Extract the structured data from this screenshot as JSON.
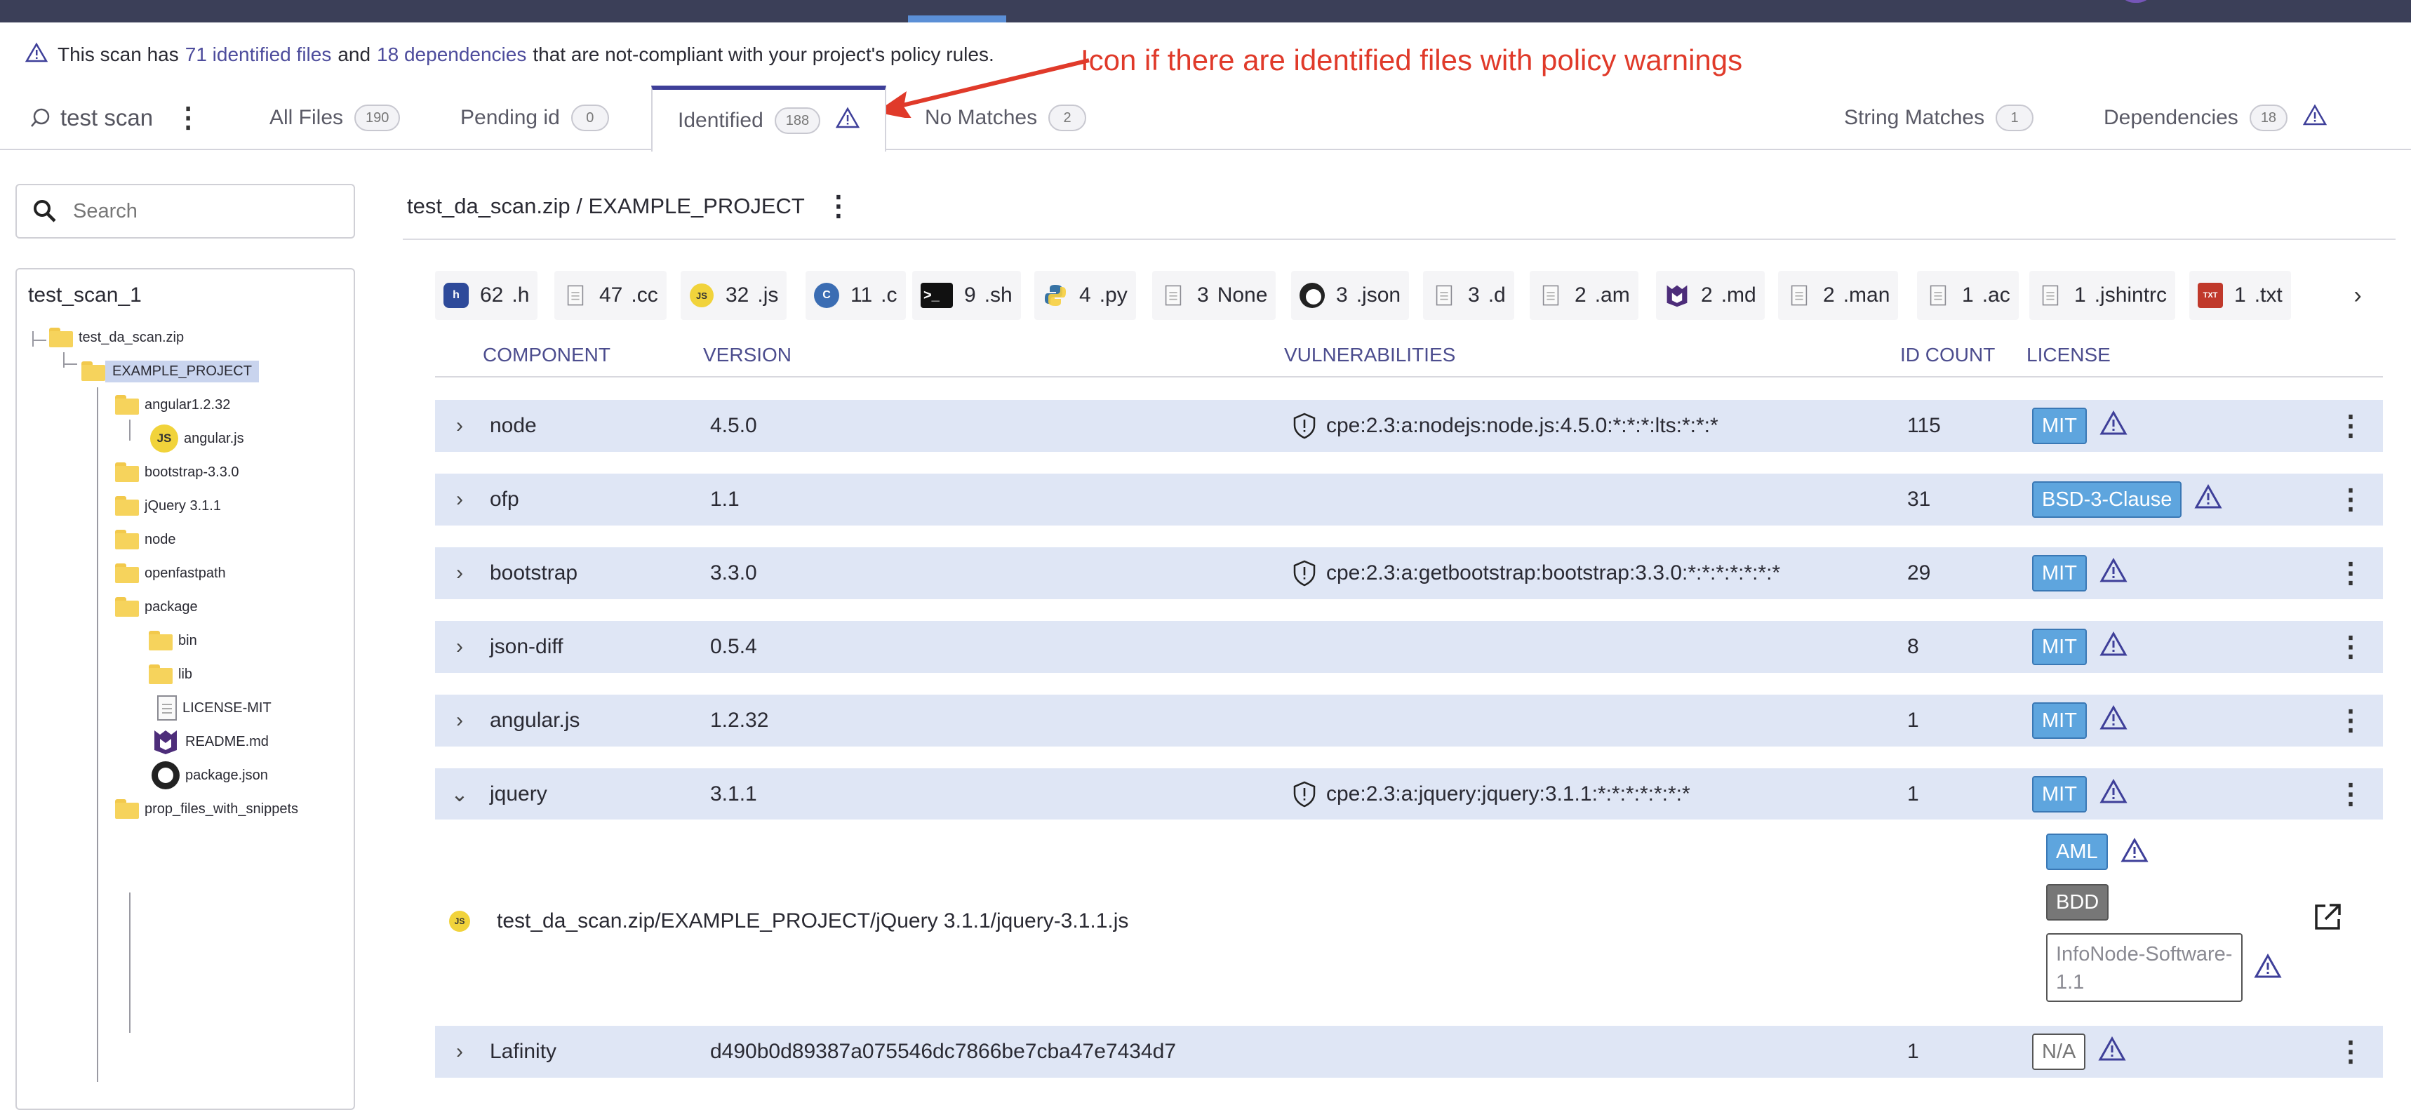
{
  "notice": {
    "prefix": "This scan has",
    "identified_link": "71 identified files",
    "middle": "and",
    "dependencies_link": "18 dependencies",
    "suffix": "that are not-compliant with your project's policy rules."
  },
  "annotation": {
    "text": "Icon if there are identified files with policy warnings"
  },
  "scan": {
    "name": "test scan"
  },
  "tabs": [
    {
      "label": "All Files",
      "count": "190"
    },
    {
      "label": "Pending id",
      "count": "0"
    },
    {
      "label": "Identified",
      "count": "188"
    },
    {
      "label": "No Matches",
      "count": "2"
    },
    {
      "label": "String Matches",
      "count": "1"
    },
    {
      "label": "Dependencies",
      "count": "18"
    }
  ],
  "search": {
    "placeholder": "Search"
  },
  "tree": {
    "root": "test_scan_1",
    "nodes": [
      {
        "label": "test_da_scan.zip",
        "icon": "folder-icon"
      },
      {
        "label": "EXAMPLE_PROJECT",
        "icon": "folder-icon"
      },
      {
        "label": "angular1.2.32",
        "icon": "folder-icon"
      },
      {
        "label": "angular.js",
        "icon": "javascript-icon"
      },
      {
        "label": "bootstrap-3.3.0",
        "icon": "folder-icon"
      },
      {
        "label": "jQuery 3.1.1",
        "icon": "folder-icon"
      },
      {
        "label": "node",
        "icon": "folder-icon"
      },
      {
        "label": "openfastpath",
        "icon": "folder-icon"
      },
      {
        "label": "package",
        "icon": "folder-icon"
      },
      {
        "label": "bin",
        "icon": "folder-icon"
      },
      {
        "label": "lib",
        "icon": "folder-icon"
      },
      {
        "label": "LICENSE-MIT",
        "icon": "document-icon"
      },
      {
        "label": "README.md",
        "icon": "markdown-icon"
      },
      {
        "label": "package.json",
        "icon": "json-icon"
      },
      {
        "label": "prop_files_with_snippets",
        "icon": "folder-icon"
      }
    ]
  },
  "breadcrumb": {
    "path": "test_da_scan.zip / EXAMPLE_PROJECT"
  },
  "extensions": [
    {
      "count": "62",
      "ext": ".h",
      "icon": "h-file-icon"
    },
    {
      "count": "47",
      "ext": ".cc",
      "icon": "document-icon"
    },
    {
      "count": "32",
      "ext": ".js",
      "icon": "javascript-icon"
    },
    {
      "count": "11",
      "ext": ".c",
      "icon": "c-file-icon"
    },
    {
      "count": "9",
      "ext": ".sh",
      "icon": "terminal-icon"
    },
    {
      "count": "4",
      "ext": ".py",
      "icon": "python-icon"
    },
    {
      "count": "3",
      "ext": "None",
      "icon": "document-icon"
    },
    {
      "count": "3",
      "ext": ".json",
      "icon": "json-icon"
    },
    {
      "count": "3",
      "ext": ".d",
      "icon": "document-icon"
    },
    {
      "count": "2",
      "ext": ".am",
      "icon": "document-icon"
    },
    {
      "count": "2",
      "ext": ".md",
      "icon": "markdown-icon"
    },
    {
      "count": "2",
      "ext": ".man",
      "icon": "document-icon"
    },
    {
      "count": "1",
      "ext": ".ac",
      "icon": "document-icon"
    },
    {
      "count": "1",
      "ext": ".jshintrc",
      "icon": "document-icon"
    },
    {
      "count": "1",
      "ext": ".txt",
      "icon": "txt-file-icon"
    }
  ],
  "table": {
    "headers": {
      "component": "COMPONENT",
      "version": "VERSION",
      "vulnerabilities": "VULNERABILITIES",
      "id_count": "ID COUNT",
      "license": "LICENSE"
    },
    "rows": [
      {
        "component": "node",
        "version": "4.5.0",
        "vulnerability": "cpe:2.3:a:nodejs:node.js:4.5.0:*:*:*:lts:*:*:*",
        "id_count": "115",
        "license": "MIT"
      },
      {
        "component": "ofp",
        "version": "1.1",
        "vulnerability": "",
        "id_count": "31",
        "license": "BSD-3-Clause"
      },
      {
        "component": "bootstrap",
        "version": "3.3.0",
        "vulnerability": "cpe:2.3:a:getbootstrap:bootstrap:3.3.0:*:*:*:*:*:*:*",
        "id_count": "29",
        "license": "MIT"
      },
      {
        "component": "json-diff",
        "version": "0.5.4",
        "vulnerability": "",
        "id_count": "8",
        "license": "MIT"
      },
      {
        "component": "angular.js",
        "version": "1.2.32",
        "vulnerability": "",
        "id_count": "1",
        "license": "MIT"
      },
      {
        "component": "jquery",
        "version": "3.1.1",
        "vulnerability": "cpe:2.3:a:jquery:jquery:3.1.1:*:*:*:*:*:*:*",
        "id_count": "1",
        "license": "MIT"
      },
      {
        "component": "Lafinity",
        "version": "d490b0d89387a075546dc7866be7cba47e7434d7",
        "vulnerability": "",
        "id_count": "1",
        "license": "N/A"
      }
    ],
    "expanded": {
      "file_path": "test_da_scan.zip/EXAMPLE_PROJECT/jQuery 3.1.1/jquery-3.1.1.js",
      "licenses": [
        "AML",
        "BDD",
        "InfoNode-Software-1.1"
      ]
    }
  },
  "colors": {
    "topbar": "#3b3f58",
    "accent": "#3e3f99",
    "row_bg": "#dfe6f5",
    "license_badge": "#5ea5de",
    "annotation": "#e03a2a"
  }
}
